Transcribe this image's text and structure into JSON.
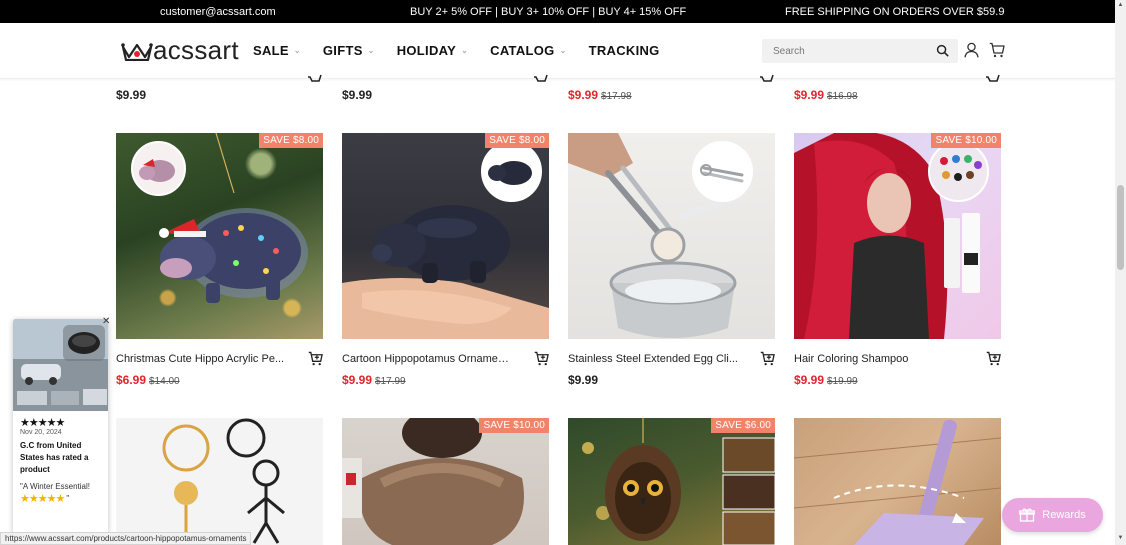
{
  "topbar": {
    "email": "customer@acssart.com",
    "promo": "BUY 2+ 5% OFF | BUY 3+ 10% OFF | BUY 4+ 15% OFF",
    "shipping": "FREE SHIPPING ON ORDERS OVER $59.9"
  },
  "header": {
    "logo": "acssart",
    "nav": [
      "SALE",
      "GIFTS",
      "HOLIDAY",
      "CATALOG",
      "TRACKING"
    ],
    "search_placeholder": "Search"
  },
  "top_row_prices": [
    {
      "price": "$9.99",
      "old": ""
    },
    {
      "price": "$9.99",
      "old": ""
    },
    {
      "price": "$9.99",
      "old": "$17.98"
    },
    {
      "price": "$9.99",
      "old": "$16.98"
    }
  ],
  "products": [
    {
      "title": "Christmas Cute Hippo Acrylic Pe...",
      "price": "$6.99",
      "old": "$14.00",
      "save": "SAVE $8.00"
    },
    {
      "title": "Cartoon Hippopotamus Ornaments",
      "price": "$9.99",
      "old": "$17.99",
      "save": "SAVE $8.00"
    },
    {
      "title": "Stainless Steel Extended Egg Cli...",
      "price": "$9.99",
      "old": "",
      "save": ""
    },
    {
      "title": "Hair Coloring Shampoo",
      "price": "$9.99",
      "old": "$19.99",
      "save": "SAVE $10.00"
    }
  ],
  "bottom_row": [
    {
      "save": ""
    },
    {
      "save": "SAVE $10.00"
    },
    {
      "save": "SAVE $6.00"
    },
    {
      "save": ""
    }
  ],
  "review_popup": {
    "stars": "★★★★★",
    "date": "Nov 20, 2024",
    "reviewer": "G.C from United States has rated a product",
    "quote": "\"A Winter Essential!",
    "rating_stars": "★★★★★",
    "quote_end": "\""
  },
  "status_url": "https://www.acssart.com/products/cartoon-hippopotamus-ornaments",
  "rewards_label": "Rewards",
  "colors": {
    "sale_red": "#e2242a",
    "save_badge": "#f2836b",
    "rewards": "#eaa6df"
  }
}
